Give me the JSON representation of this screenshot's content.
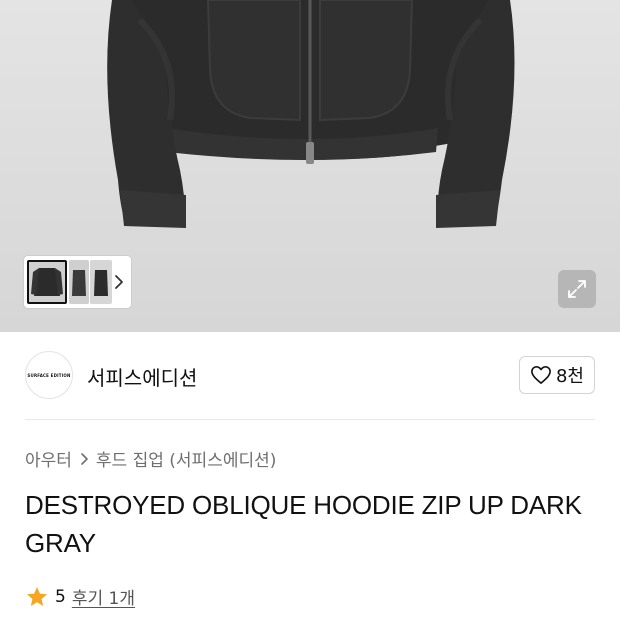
{
  "product": {
    "brand": {
      "name": "서피스에디션",
      "logo_text": "SURFACE EDITION"
    },
    "like_count": "8천",
    "breadcrumb": {
      "category": "아우터",
      "subcategory": "후드 집업 (서피스에디션)"
    },
    "title": "DESTROYED OBLIQUE HOODIE ZIP UP DARK GRAY",
    "rating": {
      "score": "5",
      "review_link": "후기 1개"
    }
  },
  "icons": {
    "like": "heart-icon",
    "expand": "expand-icon",
    "next": "chevron-right-icon",
    "star": "star-icon",
    "separator": "chevron-right-icon"
  },
  "colors": {
    "star": "#f5a623",
    "text": "#111111",
    "muted": "#6f6f6f"
  }
}
